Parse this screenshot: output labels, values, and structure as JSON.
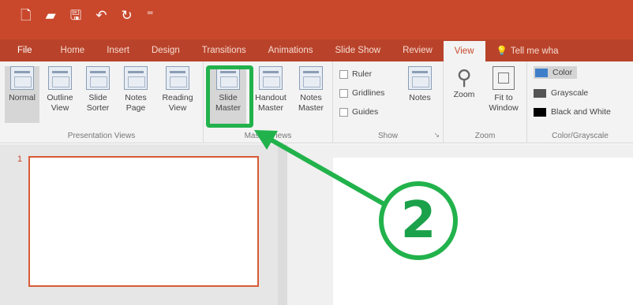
{
  "quick_access": {
    "icons": [
      "new-file-icon",
      "open-folder-icon",
      "save-icon",
      "undo-icon",
      "redo-icon",
      "customize-icon"
    ],
    "glyphs": [
      "🗋",
      "▰",
      "🖫",
      "↶",
      "↻",
      "⁼"
    ]
  },
  "tabs": [
    {
      "label": "File"
    },
    {
      "label": "Home"
    },
    {
      "label": "Insert"
    },
    {
      "label": "Design"
    },
    {
      "label": "Transitions"
    },
    {
      "label": "Animations"
    },
    {
      "label": "Slide Show"
    },
    {
      "label": "Review"
    },
    {
      "label": "View",
      "active": true
    },
    {
      "label": "Tell me wha"
    }
  ],
  "ribbon": {
    "presentation_views": {
      "label": "Presentation Views",
      "buttons": [
        {
          "label": "Normal",
          "selected": true
        },
        {
          "label": "Outline\nView"
        },
        {
          "label": "Slide\nSorter"
        },
        {
          "label": "Notes\nPage"
        },
        {
          "label": "Reading\nView"
        }
      ]
    },
    "master_views": {
      "label": "Master Views",
      "buttons": [
        {
          "label": "Slide\nMaster",
          "selected": true
        },
        {
          "label": "Handout\nMaster"
        },
        {
          "label": "Notes\nMaster"
        }
      ]
    },
    "show": {
      "label": "Show",
      "checkboxes": [
        "Ruler",
        "Gridlines",
        "Guides"
      ],
      "notes_label": "Notes",
      "launcher": "↘"
    },
    "zoom": {
      "label": "Zoom",
      "zoom_label": "Zoom",
      "fit_label": "Fit to\nWindow"
    },
    "color_grayscale": {
      "label": "Color/Grayscale",
      "options": [
        {
          "label": "Color",
          "selected": true,
          "swatch": "#3f7fc9"
        },
        {
          "label": "Grayscale",
          "swatch": "#555555"
        },
        {
          "label": "Black and White",
          "swatch": "#000000"
        }
      ]
    }
  },
  "slides_pane": {
    "slide_number": "1"
  },
  "annotation": {
    "step": "2",
    "color": "#22b24c"
  },
  "colors": {
    "title_bar": "#c9482c",
    "accent": "#d85a37"
  }
}
